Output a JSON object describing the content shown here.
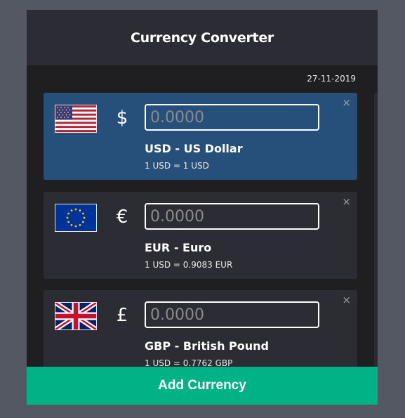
{
  "header": {
    "title": "Currency Converter"
  },
  "date": "27-11-2019",
  "currencies": [
    {
      "flag": "us-flag-icon",
      "symbol": "$",
      "placeholder": "0.0000",
      "name": "USD - US Dollar",
      "rate": "1 USD = 1 USD",
      "close": "×",
      "active": true
    },
    {
      "flag": "eu-flag-icon",
      "symbol": "€",
      "placeholder": "0.0000",
      "name": "EUR - Euro",
      "rate": "1 USD = 0.9083 EUR",
      "close": "×",
      "active": false
    },
    {
      "flag": "uk-flag-icon",
      "symbol": "£",
      "placeholder": "0.0000",
      "name": "GBP - British Pound",
      "rate": "1 USD = 0.7762 GBP",
      "close": "×",
      "active": false
    }
  ],
  "footer": {
    "add_label": "Add Currency"
  },
  "colors": {
    "active_card": "#26507a",
    "card": "#2c2d34",
    "accent": "#00b386",
    "page_bg": "#545862"
  }
}
